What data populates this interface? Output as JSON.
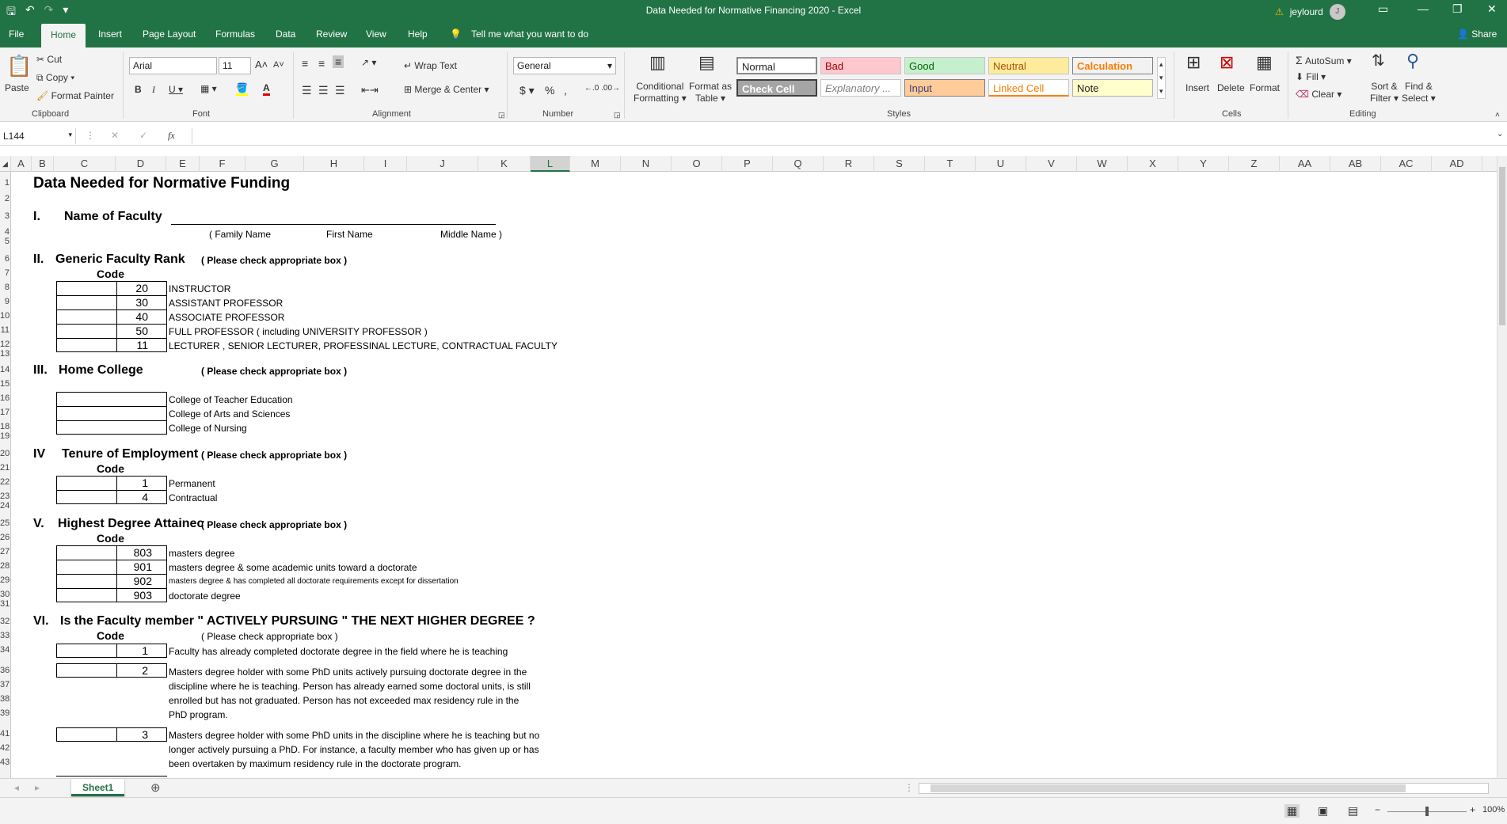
{
  "title": "Data Needed for Normative Financing 2020  -  Excel",
  "user": {
    "name": "jeylourd",
    "initial": "J"
  },
  "tabs": [
    "File",
    "Home",
    "Insert",
    "Page Layout",
    "Formulas",
    "Data",
    "Review",
    "View",
    "Help"
  ],
  "tell_me": "Tell me what you want to do",
  "share": "Share",
  "clipboard": {
    "paste": "Paste",
    "cut": "Cut",
    "copy": "Copy",
    "format_painter": "Format Painter",
    "label": "Clipboard"
  },
  "font": {
    "name": "Arial",
    "size": "11",
    "label": "Font"
  },
  "alignment": {
    "wrap": "Wrap Text",
    "merge": "Merge & Center",
    "label": "Alignment"
  },
  "number": {
    "format": "General",
    "label": "Number"
  },
  "styles": {
    "conditional": "Conditional",
    "formatting": "Formatting",
    "format_as": "Format as",
    "table": "Table",
    "normal": "Normal",
    "bad": "Bad",
    "good": "Good",
    "neutral": "Neutral",
    "calculation": "Calculation",
    "check_cell": "Check Cell",
    "explanatory": "Explanatory ...",
    "input": "Input",
    "linked_cell": "Linked Cell",
    "note": "Note",
    "label": "Styles"
  },
  "cells": {
    "insert": "Insert",
    "delete": "Delete",
    "format": "Format",
    "label": "Cells"
  },
  "editing": {
    "autosum": "AutoSum",
    "fill": "Fill",
    "clear": "Clear",
    "sort": "Sort &",
    "filter": "Filter",
    "find": "Find &",
    "select": "Select",
    "label": "Editing"
  },
  "namebox": "L144",
  "fx": "fx",
  "columns": [
    "A",
    "B",
    "C",
    "D",
    "E",
    "F",
    "G",
    "H",
    "I",
    "J",
    "K",
    "L",
    "M",
    "N",
    "O",
    "P",
    "Q",
    "R",
    "S",
    "T",
    "U",
    "V",
    "W",
    "X",
    "Y",
    "Z",
    "AA",
    "AB",
    "AC",
    "AD"
  ],
  "rows": [
    "1",
    "2",
    "3",
    "4",
    "5",
    "6",
    "7",
    "8",
    "9",
    "10",
    "11",
    "12",
    "13",
    "14",
    "15",
    "16",
    "17",
    "18",
    "19",
    "20",
    "21",
    "22",
    "23",
    "24",
    "25",
    "26",
    "27",
    "28",
    "29",
    "30",
    "31",
    "32",
    "33",
    "34",
    "36",
    "37",
    "38",
    "39",
    "41",
    "42",
    "43"
  ],
  "sheet": {
    "heading": "Data Needed for Normative Funding",
    "s1_num": "I.",
    "s1_title": "Name of Faculty",
    "family": "( Family Name",
    "first": "First Name",
    "middle": "Middle Name )",
    "s2_num": "II.",
    "s2_title": "Generic Faculty Rank",
    "check_note": "( Please check appropriate box )",
    "code": "Code",
    "rank_codes": [
      "20",
      "30",
      "40",
      "50",
      "11"
    ],
    "rank_labels": [
      "INSTRUCTOR",
      "ASSISTANT PROFESSOR",
      "ASSOCIATE PROFESSOR",
      "FULL PROFESSOR ( including UNIVERSITY PROFESSOR )",
      "LECTURER , SENIOR LECTURER, PROFESSINAL LECTURE, CONTRACTUAL FACULTY"
    ],
    "s3_num": "III.",
    "s3_title": "Home College",
    "colleges": [
      "College of Teacher Education",
      "College of Arts and Sciences",
      "College of Nursing"
    ],
    "s4_num": "IV",
    "s4_title": "Tenure of Employment",
    "tenure_codes": [
      "1",
      "4"
    ],
    "tenure_labels": [
      "Permanent",
      "Contractual"
    ],
    "s5_num": "V.",
    "s5_title": "Highest Degree Attainec",
    "degree_codes": [
      "803",
      "901",
      "902",
      "903"
    ],
    "degree_labels": [
      "masters degree",
      "masters degree & some academic units toward a doctorate",
      "masters degree & has completed all doctorate requirements except for dissertation",
      "doctorate degree"
    ],
    "s6_num": "VI.",
    "s6_title": "Is the Faculty member \" ACTIVELY PURSUING \" THE NEXT HIGHER DEGREE ?",
    "s6_note": "( Please check appropriate box )",
    "p_codes": [
      "1",
      "2",
      "3"
    ],
    "p1": "Faculty has already completed doctorate degree in the field where he is teaching",
    "p2": [
      "Masters degree holder with some PhD units actively pursuing doctorate degree in the",
      "discipline where he is teaching. Person has already earned some doctoral units, is still",
      "enrolled but has not graduated. Person has not exceeded max residency rule in the",
      "PhD program."
    ],
    "p3": [
      "Masters degree holder with some PhD units in the discipline where he is teaching but no",
      "longer actively pursuing a PhD. For instance, a faculty member who has given up or has",
      "been overtaken by maximum residency rule in the doctorate program."
    ]
  },
  "sheet_tab": "Sheet1",
  "zoom": "100%"
}
